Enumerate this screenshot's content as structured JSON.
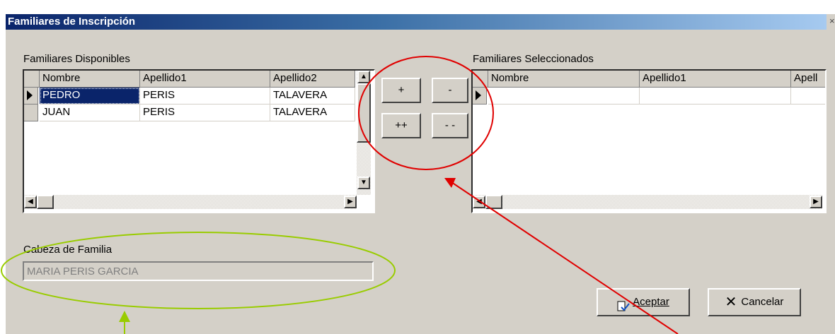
{
  "window": {
    "title": "Familiares de Inscripción",
    "close_symbol": "×"
  },
  "available": {
    "label": "Familiares Disponibles",
    "columns": [
      "Nombre",
      "Apellido1",
      "Apellido2"
    ],
    "rows": [
      [
        "PEDRO",
        "PERIS",
        "TALAVERA"
      ],
      [
        "JUAN",
        "PERIS",
        "TALAVERA"
      ]
    ]
  },
  "selected": {
    "label": "Familiares Seleccionados",
    "columns": [
      "Nombre",
      "Apellido1",
      "Apell"
    ],
    "rows": []
  },
  "transfer_buttons": {
    "add": "+",
    "remove": "-",
    "add_all": "++",
    "remove_all": "- -"
  },
  "cabeza": {
    "label": "Cabeza de Familia",
    "value": "MARIA PERIS GARCIA"
  },
  "actions": {
    "accept": "Aceptar",
    "cancel": "Cancelar"
  },
  "annotations": {
    "circle_color": "#e00000",
    "ellipse_color": "#99cc00",
    "arrow_red": "#e00000",
    "arrow_green": "#99cc00"
  }
}
